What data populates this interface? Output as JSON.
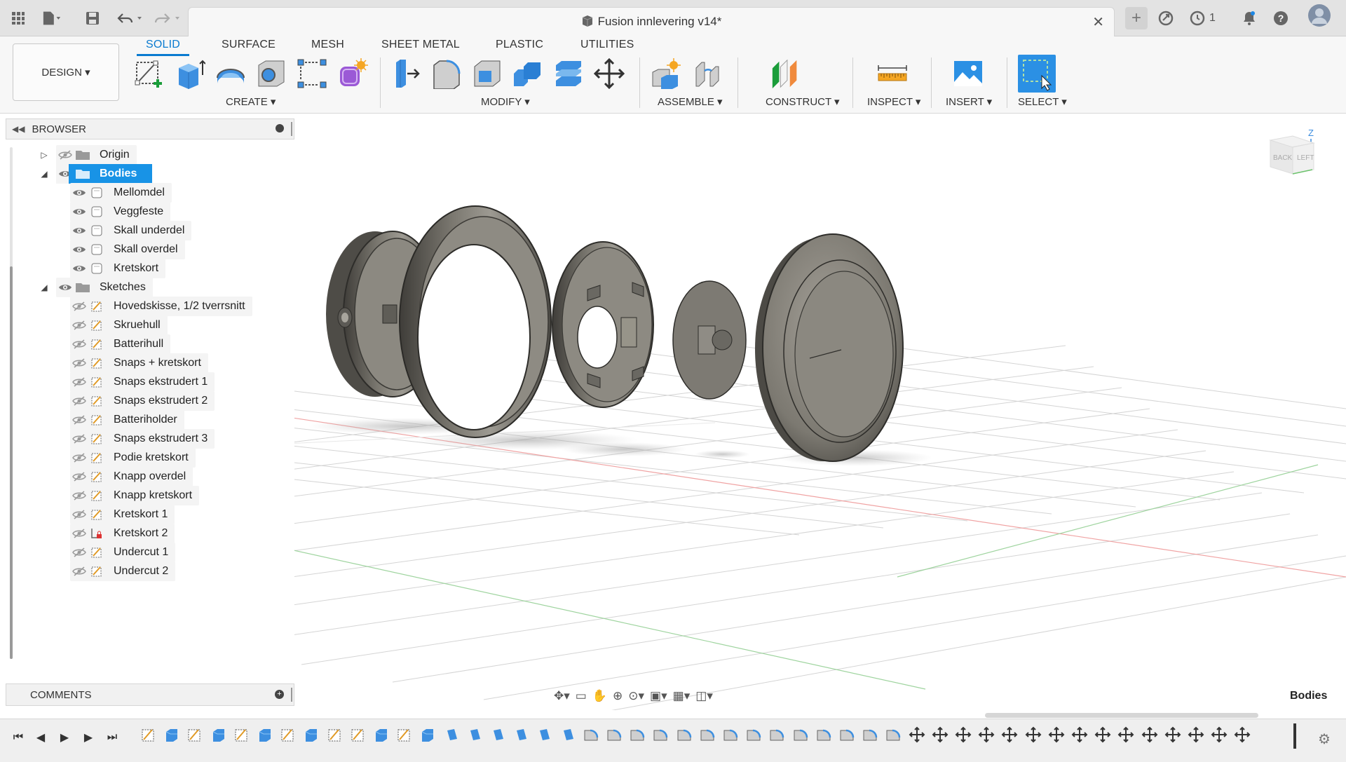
{
  "window": {
    "title": "Fusion innlevering v14*",
    "job_count": "1"
  },
  "toolbar": {
    "workspace": "DESIGN ▾",
    "tabs": [
      {
        "label": "SOLID",
        "active": true
      },
      {
        "label": "SURFACE",
        "active": false
      },
      {
        "label": "MESH",
        "active": false
      },
      {
        "label": "SHEET METAL",
        "active": false
      },
      {
        "label": "PLASTIC",
        "active": false
      },
      {
        "label": "UTILITIES",
        "active": false
      }
    ],
    "groups": {
      "create": "CREATE ▾",
      "modify": "MODIFY ▾",
      "assemble": "ASSEMBLE ▾",
      "construct": "CONSTRUCT ▾",
      "inspect": "INSPECT ▾",
      "insert": "INSERT ▾",
      "select": "SELECT ▾"
    }
  },
  "browser": {
    "title": "BROWSER",
    "origin": "Origin",
    "bodies_folder": "Bodies",
    "bodies": [
      "Mellomdel",
      "Veggfeste",
      "Skall underdel",
      "Skall overdel",
      "Kretskort"
    ],
    "sketches_folder": "Sketches",
    "sketches": [
      "Hovedskisse, 1/2 tverrsnitt",
      "Skruehull",
      "Batterihull",
      "Snaps + kretskort",
      "Snaps ekstrudert 1",
      "Snaps ekstrudert 2",
      "Batteriholder",
      "Snaps ekstrudert 3",
      "Podie kretskort",
      "Knapp overdel",
      "Knapp kretskort",
      "Kretskort 1",
      "Kretskort 2",
      "Undercut 1",
      "Undercut 2"
    ]
  },
  "comments": {
    "title": "COMMENTS"
  },
  "status": {
    "selection": "Bodies"
  },
  "viewcube": {
    "face_back": "BACK",
    "face_left": "LEFT",
    "axis_z": "Z"
  },
  "colors": {
    "accent": "#0a7bd0",
    "selection": "#1893e6",
    "body_gray": "#6f6c66"
  }
}
